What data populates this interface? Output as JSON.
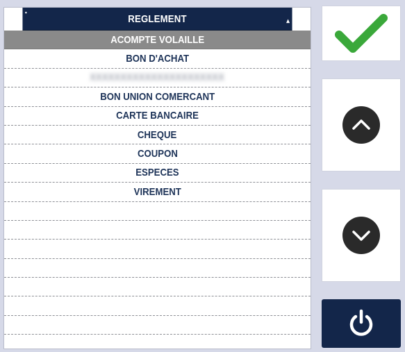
{
  "list": {
    "header": "REGLEMENT",
    "items": [
      {
        "label": "ACOMPTE VOLAILLE",
        "selected": true
      },
      {
        "label": "BON D'ACHAT",
        "selected": false
      },
      {
        "label": "REDACTED ENTRY",
        "selected": false,
        "blurred": true
      },
      {
        "label": "BON UNION COMERCANT",
        "selected": false
      },
      {
        "label": "CARTE BANCAIRE",
        "selected": false
      },
      {
        "label": "CHEQUE",
        "selected": false
      },
      {
        "label": "COUPON",
        "selected": false
      },
      {
        "label": "ESPECES",
        "selected": false
      },
      {
        "label": "VIREMENT",
        "selected": false
      }
    ],
    "empty_rows": 8
  },
  "buttons": {
    "validate_icon": "checkmark-icon",
    "up_icon": "chevron-up-icon",
    "down_icon": "chevron-down-icon",
    "power_icon": "power-icon"
  },
  "colors": {
    "header_bg": "#13264a",
    "selected_bg": "#8a8a8a",
    "item_text": "#1d3358",
    "check_green": "#3aa83a",
    "page_bg": "#d6d9e8"
  }
}
